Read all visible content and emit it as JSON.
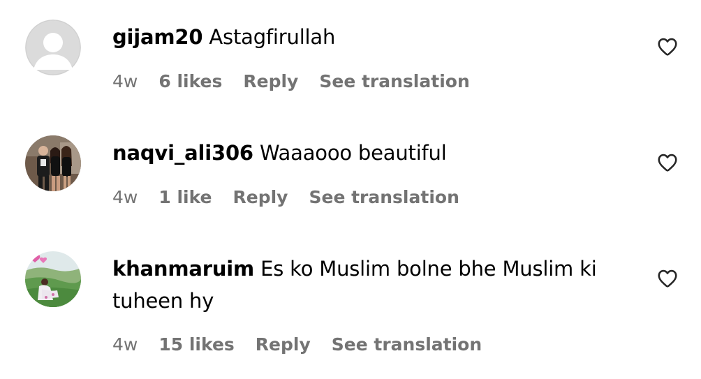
{
  "comments": [
    {
      "username": "gijam20",
      "text": "Astagfirullah",
      "time": "4w",
      "likes": "6 likes",
      "reply": "Reply",
      "see_translation": "See translation",
      "avatar": "default-avatar-icon",
      "like_icon": "heart-outline-icon"
    },
    {
      "username": "naqvi_ali306",
      "text": "Waaaooo beautiful",
      "time": "4w",
      "likes": "1 like",
      "reply": "Reply",
      "see_translation": "See translation",
      "avatar": "profile-photo",
      "like_icon": "heart-outline-icon"
    },
    {
      "username": "khanmaruim",
      "text": "Es ko Muslim bolne bhe Muslim ki tuheen hy",
      "time": "4w",
      "likes": "15 likes",
      "reply": "Reply",
      "see_translation": "See translation",
      "avatar": "profile-photo",
      "like_icon": "heart-outline-icon"
    }
  ],
  "colors": {
    "text": "#000000",
    "meta": "#737373",
    "avatar_placeholder_bg": "#dbdbdb"
  }
}
